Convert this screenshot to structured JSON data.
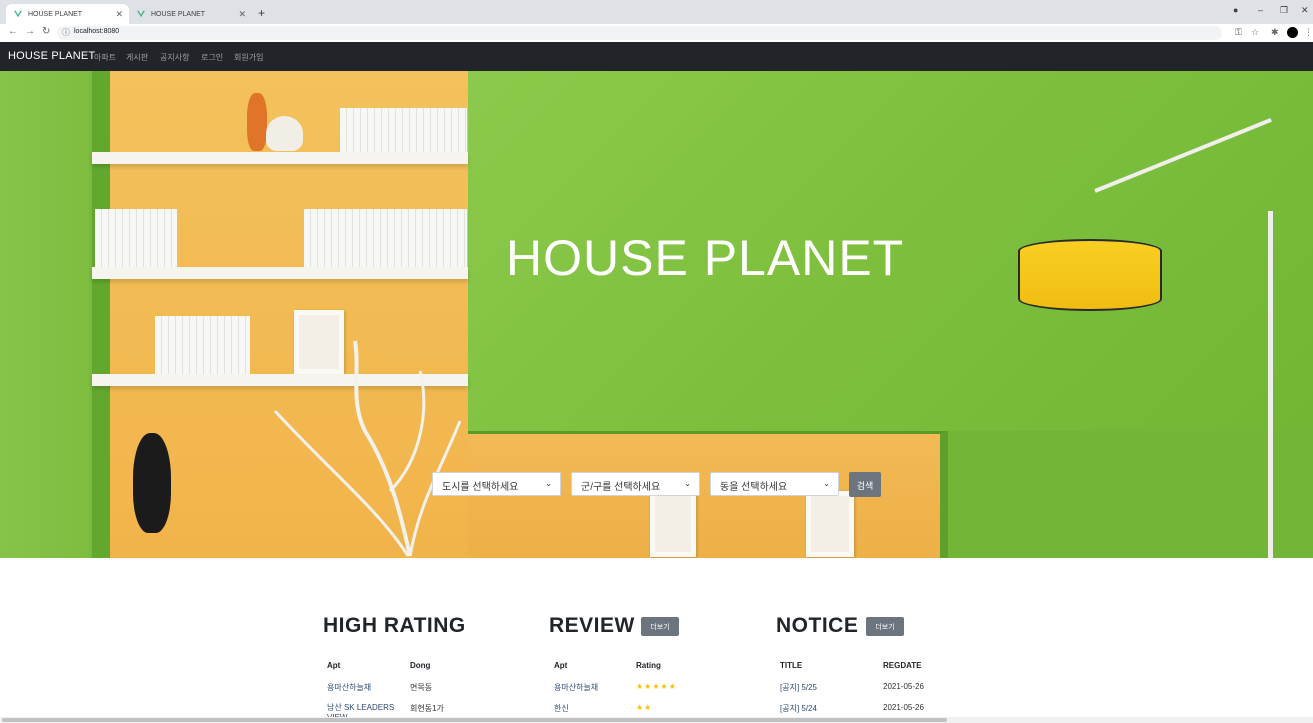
{
  "browser": {
    "tabs": [
      {
        "title": "HOUSE PLANET",
        "active": true
      },
      {
        "title": "HOUSE PLANET",
        "active": false
      }
    ],
    "url": "localhost:8080"
  },
  "navbar": {
    "brand": "HOUSE PLANET",
    "links": [
      "아파트",
      "게시판",
      "공지사항",
      "로그인",
      "회원가입"
    ]
  },
  "hero": {
    "title": "HOUSE PLANET",
    "select_city": "도시를 선택하세요",
    "select_gu": "군/구를 선택하세요",
    "select_dong": "동을 선택하세요",
    "search_button": "검색"
  },
  "high_rating": {
    "title": "HIGH RATING",
    "headers": [
      "Apt",
      "Dong"
    ],
    "rows": [
      [
        "용마산하늘채",
        "면목동"
      ],
      [
        "남산 SK LEADERS VIEW",
        "회현동1가"
      ]
    ]
  },
  "review": {
    "title": "REVIEW",
    "more": "더보기",
    "headers": [
      "Apt",
      "Rating"
    ],
    "rows": [
      {
        "apt": "용마산하늘채",
        "rating": 5
      },
      {
        "apt": "한신",
        "rating": 2
      }
    ]
  },
  "notice": {
    "title": "NOTICE",
    "more": "더보기",
    "headers": [
      "TITLE",
      "REGDATE"
    ],
    "rows": [
      [
        "[공지] 5/25",
        "2021-05-26"
      ],
      [
        "[공지] 5/24",
        "2021-05-26"
      ]
    ]
  },
  "colors": {
    "navbar": "#212529",
    "hero_green": "#7fc043",
    "hero_yellow": "#f4c15c",
    "button_gray": "#6c757d",
    "star": "#f4c20d"
  }
}
